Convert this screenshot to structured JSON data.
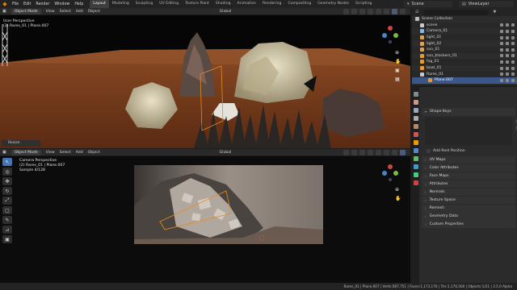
{
  "app": {
    "logo_icon": "blender-logo-icon",
    "menus": [
      "File",
      "Edit",
      "Render",
      "Window",
      "Help"
    ],
    "workspace_tabs": [
      "Layout",
      "Modeling",
      "Sculpting",
      "UV Editing",
      "Texture Paint",
      "Shading",
      "Animation",
      "Rendering",
      "Compositing",
      "Geometry Nodes",
      "Scripting"
    ],
    "active_workspace": "Layout",
    "scene": "Scene",
    "view_layer": "ViewLayer"
  },
  "top_viewport": {
    "mode": "Object Mode",
    "menus": [
      "View",
      "Select",
      "Add",
      "Object"
    ],
    "transform": "Global",
    "info_line1": "User Perspective",
    "info_line2": "(2) Rares_01 | Plane.007",
    "operator_panel": "Resize"
  },
  "bottom_viewport": {
    "mode": "Object Mode",
    "menus": [
      "View",
      "Select",
      "Add",
      "Object"
    ],
    "transform": "Global",
    "info_line1": "Camera Perspective",
    "info_line2": "(2) Rares_01 | Plane.007",
    "info_line3": "Sample 4/128"
  },
  "outliner": {
    "root": "Scene Collection",
    "items": [
      {
        "label": "scene",
        "icon": "collection-icon",
        "color": "#c9c9c9"
      },
      {
        "label": "Camera_01",
        "icon": "camera-icon",
        "color": "#8fb3d9"
      },
      {
        "label": "light_01",
        "icon": "light-icon",
        "color": "#d9a25c"
      },
      {
        "label": "light_02",
        "icon": "light-icon",
        "color": "#d9a25c"
      },
      {
        "label": "sun_01",
        "icon": "sun-icon",
        "color": "#d9a25c"
      },
      {
        "label": "sun_blockers_01",
        "icon": "mesh-icon",
        "color": "#e09a3c"
      },
      {
        "label": "fog_01",
        "icon": "mesh-icon",
        "color": "#e09a3c"
      },
      {
        "label": "boat_01",
        "icon": "mesh-icon",
        "color": "#e09a3c"
      },
      {
        "label": "Rares_01",
        "icon": "collection-icon",
        "color": "#c9c9c9"
      },
      {
        "label": "Plane.007",
        "icon": "mesh-icon",
        "color": "#e09a3c",
        "selected": true
      }
    ]
  },
  "properties": {
    "shape_keys": "Shape Keys",
    "add_rest_position": "Add Rest Position",
    "sections": [
      "UV Maps",
      "Color Attributes",
      "Face Maps",
      "Attributes",
      "Normals",
      "Texture Space",
      "Remesh",
      "Geometry Data",
      "Custom Properties"
    ]
  },
  "status_bar": "Rares_01 | Plane.007 | Verts:587,751 | Faces:1,173,176 | Tris:1,176,500 | Objects:1/21 | 3.5.0 Alpha",
  "colors": {
    "accent": "#4772b3",
    "orange": "#e87d0d",
    "ground": "#7a3a1a"
  }
}
